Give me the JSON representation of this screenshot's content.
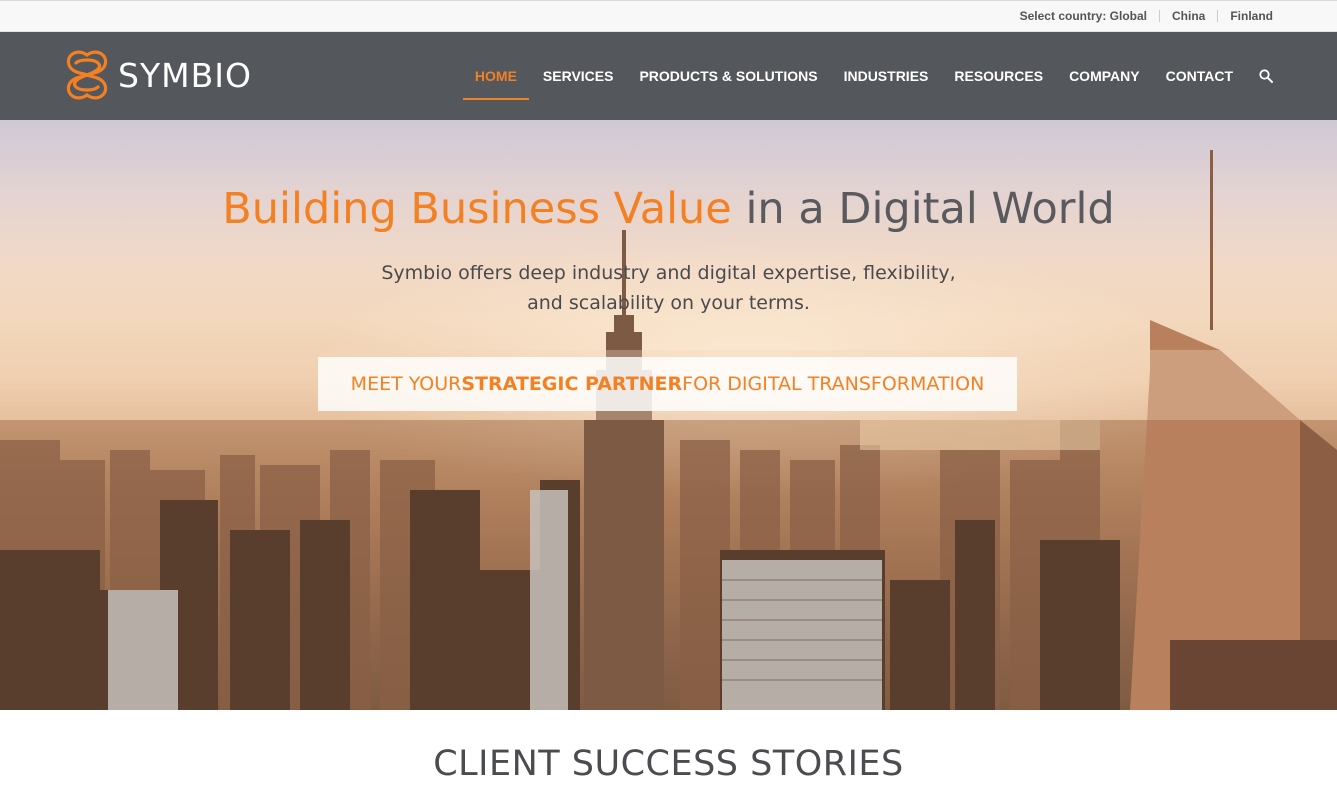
{
  "country_bar": {
    "label": "Select country: Global",
    "options": [
      "China",
      "Finland"
    ]
  },
  "brand": {
    "name": "SYMBIO",
    "logo_icon": "knot-logo-icon",
    "accent_color": "#f48024",
    "header_bg": "#54575b"
  },
  "nav": {
    "items": [
      {
        "label": "HOME",
        "active": true
      },
      {
        "label": "SERVICES"
      },
      {
        "label": "PRODUCTS & SOLUTIONS"
      },
      {
        "label": "INDUSTRIES"
      },
      {
        "label": "RESOURCES"
      },
      {
        "label": "COMPANY"
      },
      {
        "label": "CONTACT"
      }
    ],
    "search_icon": "search-icon"
  },
  "hero": {
    "title_accent": "Building Business Value",
    "title_rest": " in a Digital World",
    "subtitle_line1": "Symbio offers deep industry and digital expertise, flexibility,",
    "subtitle_line2": "and scalability on your terms.",
    "cta_pre": "MEET YOUR ",
    "cta_bold": "STRATEGIC PARTNER",
    "cta_post": " FOR DIGITAL TRANSFORMATION"
  },
  "section": {
    "title": "CLIENT SUCCESS STORIES"
  }
}
